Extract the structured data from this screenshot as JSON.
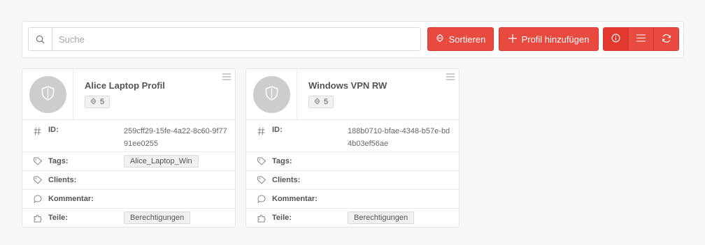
{
  "search": {
    "placeholder": "Suche",
    "value": ""
  },
  "toolbar": {
    "sort_label": "Sortieren",
    "add_label": "Profil hinzufügen",
    "accent_color": "#e84a3f"
  },
  "cards": [
    {
      "title": "Alice Laptop Profil",
      "count": "5",
      "labels": {
        "id": "ID:",
        "tags": "Tags:",
        "clients": "Clients:",
        "comment": "Kommentar:",
        "parts": "Teile:"
      },
      "id_value": "259cff29-15fe-4a22-8c60-9f7791ee0255",
      "tag": "Alice_Laptop_Win",
      "parts": "Berechtigungen"
    },
    {
      "title": "Windows VPN RW",
      "count": "5",
      "labels": {
        "id": "ID:",
        "tags": "Tags:",
        "clients": "Clients:",
        "comment": "Kommentar:",
        "parts": "Teile:"
      },
      "id_value": "188b0710-bfae-4348-b57e-bd4b03ef56ae",
      "tag": "",
      "parts": "Berechtigungen"
    }
  ],
  "icons": [
    "search-icon",
    "sort-icon",
    "plus-icon",
    "info-icon",
    "list-icon",
    "refresh-icon",
    "shield-icon",
    "hash-icon",
    "tag-icon",
    "comment-icon",
    "puzzle-icon",
    "menu-icon"
  ]
}
